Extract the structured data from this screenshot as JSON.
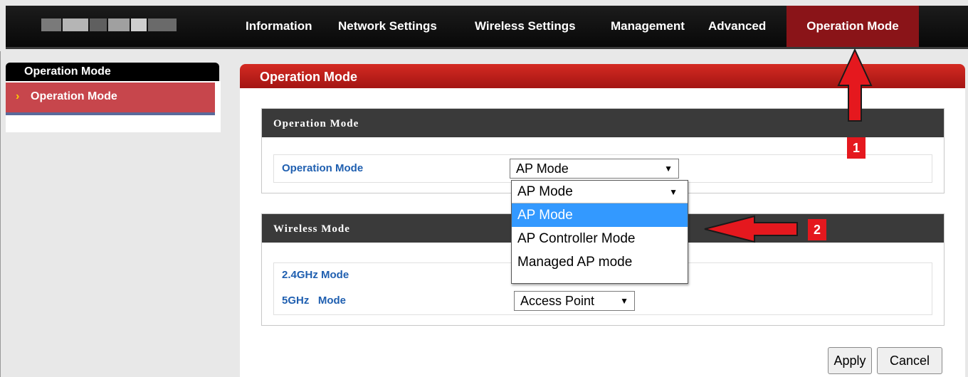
{
  "nav": {
    "items": [
      "Information",
      "Network Settings",
      "Wireless Settings",
      "Management",
      "Advanced",
      "Operation Mode"
    ],
    "active_index": 5
  },
  "sidebar": {
    "header": "Operation Mode",
    "items": [
      {
        "label": "Operation Mode",
        "active": true
      }
    ]
  },
  "main": {
    "title": "Operation Mode",
    "operation_section": {
      "title": "Operation Mode",
      "field_label": "Operation Mode",
      "selected_value": "AP Mode"
    },
    "dropdown": {
      "current": "AP Mode",
      "options": [
        "AP Mode",
        "AP Controller Mode",
        "Managed AP mode"
      ],
      "highlighted_index": 0
    },
    "wireless_section": {
      "title": "Wireless Mode",
      "rows": [
        {
          "label": "2.4GHz Mode",
          "value": ""
        },
        {
          "label": "5GHz   Mode",
          "value": "Access Point"
        }
      ]
    },
    "buttons": {
      "apply": "Apply",
      "cancel": "Cancel"
    }
  },
  "annotations": {
    "badge_1": "1",
    "badge_2": "2"
  },
  "colors": {
    "accent_red": "#c41e1a",
    "nav_active": "#8a1418",
    "label_blue": "#1f5fb0",
    "dropdown_highlight": "#3399ff"
  }
}
